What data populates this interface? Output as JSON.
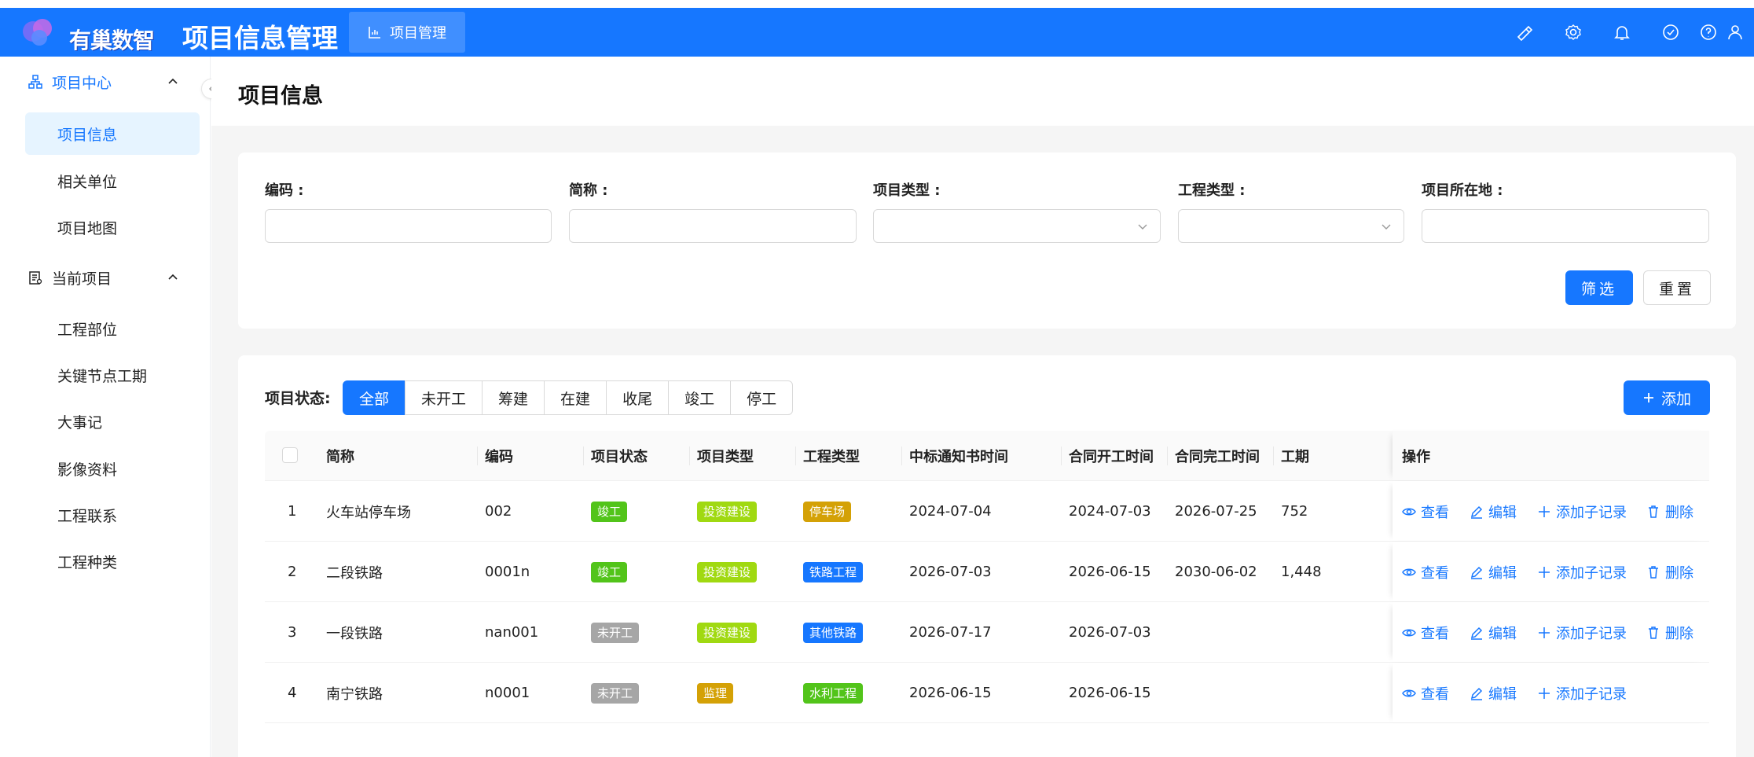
{
  "header": {
    "logo_text": "有巢数智",
    "app_title": "项目信息管理",
    "tab_label": "项目管理",
    "icons": [
      "brush-icon",
      "gear-icon",
      "bell-icon",
      "check-circle-icon",
      "help-icon",
      "user-icon"
    ],
    "bg_color": "#1677ff"
  },
  "sidebar": {
    "groups": [
      {
        "label": "项目中心",
        "icon": "org-tree-icon",
        "items": [
          "项目信息",
          "相关单位",
          "项目地图"
        ]
      },
      {
        "label": "当前项目",
        "icon": "clipboard-icon",
        "items": [
          "工程部位",
          "关键节点工期",
          "大事记",
          "影像资料",
          "工程联系",
          "工程种类"
        ]
      }
    ],
    "active_item": "项目信息"
  },
  "page": {
    "title": "项目信息"
  },
  "filters": {
    "code_label": "编码 :",
    "short_label": "简称 :",
    "project_type_label": "项目类型 :",
    "engineering_type_label": "工程类型 :",
    "location_label": "项目所在地 :",
    "code_value": "",
    "short_value": "",
    "location_value": "",
    "filter_btn": "筛选",
    "reset_btn": "重置"
  },
  "status_filter": {
    "label": "项目状态:",
    "options": [
      "全部",
      "未开工",
      "筹建",
      "在建",
      "收尾",
      "竣工",
      "停工"
    ],
    "active": "全部"
  },
  "add_btn": "添加",
  "table": {
    "columns": [
      "简称",
      "编码",
      "项目状态",
      "项目类型",
      "工程类型",
      "中标通知书时间",
      "合同开工时间",
      "合同完工时间",
      "工期",
      "操作"
    ],
    "rows": [
      {
        "idx": "1",
        "name": "火车站停车场",
        "code": "002",
        "status": "竣工",
        "status_color": "#52c41a",
        "ptype": "投资建设",
        "ptype_color": "#a0d911",
        "etype": "停车场",
        "etype_color": "#d4a106",
        "bid": "2024-07-04",
        "start": "2024-07-03",
        "end": "2026-07-25",
        "period": "752",
        "can_delete": true
      },
      {
        "idx": "2",
        "name": "二段铁路",
        "code": "0001n",
        "status": "竣工",
        "status_color": "#52c41a",
        "ptype": "投资建设",
        "ptype_color": "#a0d911",
        "etype": "铁路工程",
        "etype_color": "#1677ff",
        "bid": "2026-07-03",
        "start": "2026-06-15",
        "end": "2030-06-02",
        "period": "1,448",
        "can_delete": true
      },
      {
        "idx": "3",
        "name": "一段铁路",
        "code": "nan001",
        "status": "未开工",
        "status_color": "#a6a6a6",
        "ptype": "投资建设",
        "ptype_color": "#a0d911",
        "etype": "其他铁路",
        "etype_color": "#1677ff",
        "bid": "2026-07-17",
        "start": "2026-07-03",
        "end": "",
        "period": "",
        "can_delete": true
      },
      {
        "idx": "4",
        "name": "南宁铁路",
        "code": "n0001",
        "status": "未开工",
        "status_color": "#a6a6a6",
        "ptype": "监理",
        "ptype_color": "#d4a106",
        "etype": "水利工程",
        "etype_color": "#52c41a",
        "bid": "2026-06-15",
        "start": "2026-06-15",
        "end": "",
        "period": "",
        "can_delete": false
      }
    ],
    "actions": {
      "view": "查看",
      "edit": "编辑",
      "add_child": "添加子记录",
      "delete": "删除"
    }
  }
}
